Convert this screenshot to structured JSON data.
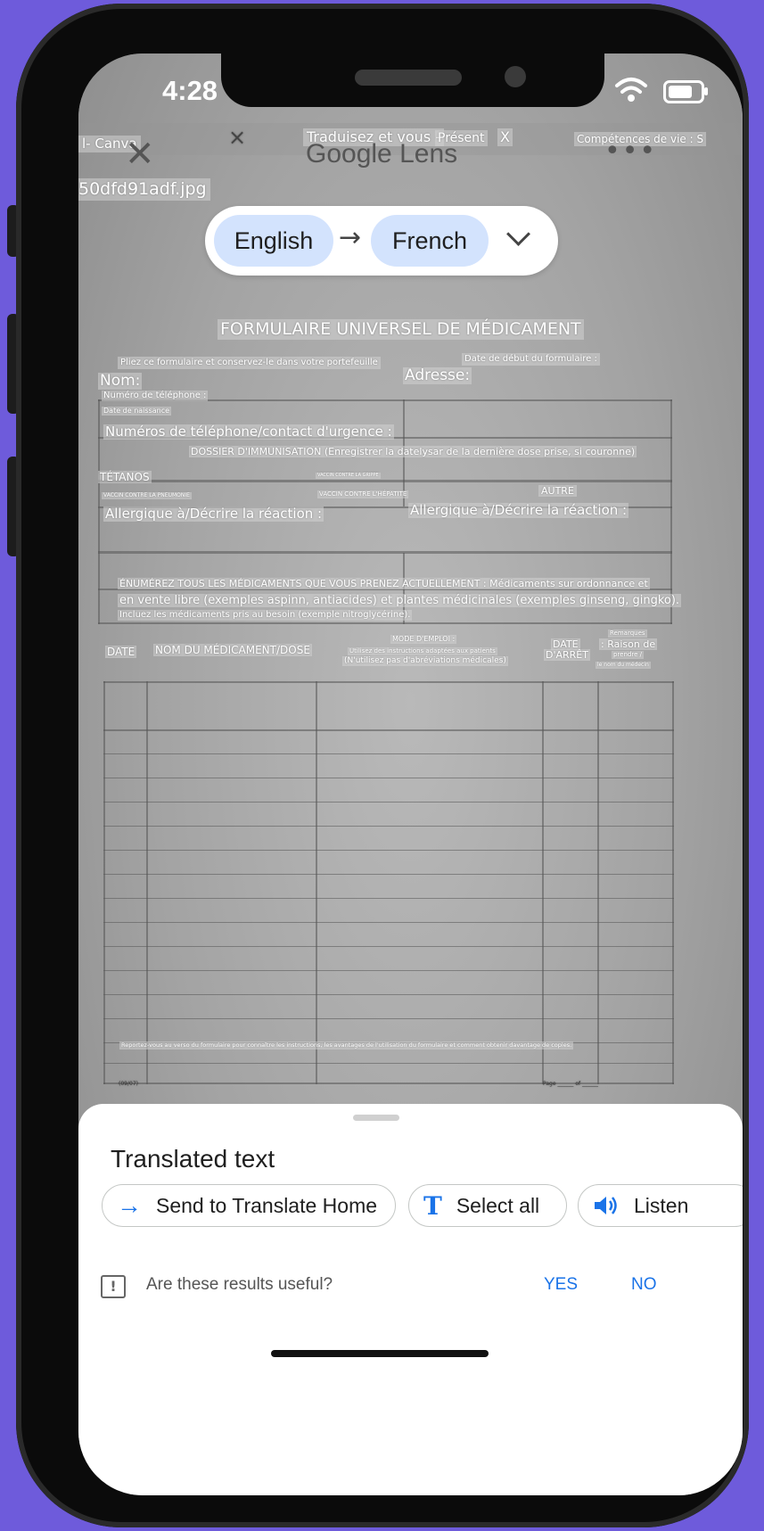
{
  "status_bar": {
    "time": "4:28"
  },
  "browser": {
    "tab_left": "l- Canva",
    "tab_close": "×",
    "tab_center": "Traduisez et vous -",
    "tab_present": "Présent",
    "tab_center_close": "X",
    "tab_right": "Compétences de vie : S",
    "file_name": "50dfd91adf.jpg"
  },
  "lens": {
    "title": "Google Lens",
    "close_icon": "close-icon",
    "more_icon": "more-icon",
    "close_glyph": "✕",
    "more_glyph": "•••"
  },
  "languages": {
    "source": "English",
    "arrow": "→",
    "target": "French"
  },
  "document": {
    "title": "FORMULAIRE UNIVERSEL DE MÉDICAMENT",
    "fold_note": "Pliez ce formulaire et conservez-le dans votre portefeuille",
    "start_date": "Date de début du formulaire :",
    "name": "Nom:",
    "address": "Adresse:",
    "phone": "Numéro de téléphone :",
    "birth_date": "Date de naissance",
    "emergency": "Numéros de téléphone/contact d'urgence :",
    "immunization": "DOSSIER D'IMMUNISATION (Enregistrer la datelysar de la dernière dose prise, si couronne)",
    "tetanus": "TÉTANOS",
    "flu": "VACCIN CONTRE LA GRIPPE",
    "pneumonia": "VACCIN CONTRE LA PNEUMONIE",
    "hepatitis": "VACCIN CONTRE L'HÉPATITE",
    "other": "AUTRE",
    "allergy_left": "Allergique à/Décrire la réaction :",
    "allergy_right": "Allergique à/Décrire la réaction :",
    "list_line1": "ÉNUMÉREZ TOUS LES MÉDICAMENTS QUE VOUS PRENEZ ACTUELLEMENT : Médicaments sur ordonnance et",
    "list_line2": "en vente libre (exemples aspinn, antiacides) et plantes médicinales (exemples ginseng, gingko).",
    "list_line3": "Incluez les médicaments pris au besoin (exemple nitroglycérine).",
    "col_date": "DATE",
    "col_name": "NOM DU MÉDICAMENT/DOSE",
    "col_mode": "MODE D'EMPLOI :",
    "col_mode_sub1": "Utilisez des instructions adaptées aux patients",
    "col_mode_sub2": "(N'utilisez pas d'abréviations médicales)",
    "col_stop": "DATE",
    "col_stop2": "D'ARRÊT",
    "col_remarks": "Remarques",
    "col_reason": ": Raison de",
    "col_take": "prendre /",
    "col_doctor": "le nom du médecin",
    "footer": "Reportez-vous au verso du formulaire pour connaître les instructions, les avantages de l'utilisation du formulaire et comment obtenir davantage de copies.",
    "code": "(09/07)",
    "page": "Page ______ of ______"
  },
  "sheet": {
    "title": "Translated text",
    "send_label": "Send to Translate Home",
    "send_icon": "→",
    "select_label": "Select all",
    "select_icon": "T",
    "listen_label": "Listen",
    "listen_icon": "🔊",
    "feedback_icon": "!",
    "feedback_question": "Are these results useful?",
    "yes": "YES",
    "no": "NO"
  }
}
